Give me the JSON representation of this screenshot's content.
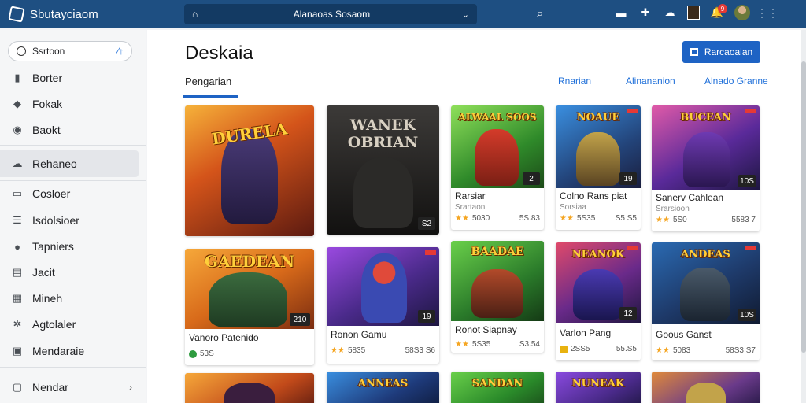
{
  "topbar": {
    "brand": "Sbutayciaom",
    "search_text": "Alanaoas Sosaom",
    "notification_count": "9"
  },
  "sidebar": {
    "search_placeholder": "Ssrtoon",
    "items": [
      {
        "label": "Borter",
        "icon": "bookmark-icon"
      },
      {
        "label": "Fokak",
        "icon": "pin-icon"
      },
      {
        "label": "Baokt",
        "icon": "compass-icon"
      },
      {
        "label": "Rehaneo",
        "icon": "cloud-icon",
        "active": true
      },
      {
        "label": "Cosloer",
        "icon": "monitor-icon"
      },
      {
        "label": "Isdolsioer",
        "icon": "list-icon"
      },
      {
        "label": "Tapniers",
        "icon": "user-icon"
      },
      {
        "label": "Jacit",
        "icon": "document-icon"
      },
      {
        "label": "Mineh",
        "icon": "calendar-icon"
      },
      {
        "label": "Agtolaler",
        "icon": "gear-icon"
      },
      {
        "label": "Mendaraie",
        "icon": "grid-icon"
      },
      {
        "label": "Nendar",
        "icon": "box-icon"
      }
    ]
  },
  "main": {
    "title": "Deskaia",
    "primary_button": "Rarcaoaian",
    "tab_active": "Pengarian",
    "tab_links": [
      "Rnarian",
      "Alinananion",
      "Alnado Granne"
    ]
  },
  "cards": [
    {
      "art_title": "DURELA",
      "rating": "",
      "name": "",
      "sub": "",
      "stars": "",
      "value": "",
      "price": ""
    },
    {
      "art_title": "WANEK OBRIAN",
      "rating": "S2",
      "name": "",
      "sub": "",
      "stars": "",
      "value": "",
      "price": ""
    },
    {
      "art_title": "ALWAAL SOOS",
      "rating": "2",
      "name": "Rarsiar",
      "sub": "Srartaon",
      "stars": "★★",
      "value": "5030",
      "price": "5S.83"
    },
    {
      "art_title": "NOAUE",
      "rating": "19",
      "name": "Colno Rans piat",
      "sub": "Sorsiaa",
      "stars": "★★",
      "value": "5S35",
      "price": "S5 S5"
    },
    {
      "art_title": "BUCEAN",
      "rating": "10S",
      "name": "Sanerv Cahlean",
      "sub": "Srarsioon",
      "stars": "★★",
      "value": "5S0",
      "price": "5583 7"
    },
    {
      "art_title": "GAEDEAN",
      "rating": "210",
      "name": "Vanoro Patenido",
      "sub": "",
      "stars": "",
      "value": "53S",
      "price": "",
      "lib": "green"
    },
    {
      "art_title": "",
      "rating": "19",
      "name": "Ronon Gamu",
      "sub": "",
      "stars": "★★",
      "value": "5835",
      "price": "58S3 S6"
    },
    {
      "art_title": "BAADAE",
      "rating": "",
      "name": "Ronot Siapnay",
      "sub": "",
      "stars": "★★",
      "value": "5S35",
      "price": "S3.54"
    },
    {
      "art_title": "NEANOK",
      "rating": "12",
      "name": "Varlon Pang",
      "sub": "",
      "stars": "",
      "value": "2SS5",
      "price": "55.S5",
      "lib": "yellow"
    },
    {
      "art_title": "ANDEAS",
      "rating": "10S",
      "name": "Goous Ganst",
      "sub": "",
      "stars": "★★",
      "value": "5083",
      "price": "58S3 S7"
    },
    {
      "art_title": "",
      "rating": "",
      "name": "",
      "sub": "",
      "stars": "",
      "value": "",
      "price": ""
    },
    {
      "art_title": "ANNEAS",
      "rating": "",
      "name": "",
      "sub": "",
      "stars": "",
      "value": "",
      "price": ""
    },
    {
      "art_title": "SANDAN",
      "rating": "",
      "name": "",
      "sub": "",
      "stars": "",
      "value": "",
      "price": ""
    },
    {
      "art_title": "NUNEAK",
      "rating": "",
      "name": "",
      "sub": "",
      "stars": "",
      "value": "",
      "price": ""
    },
    {
      "art_title": "",
      "rating": "",
      "name": "",
      "sub": "",
      "stars": "",
      "value": "",
      "price": ""
    }
  ],
  "colors": {
    "topbar": "#1e4f82",
    "accent": "#1e63c4",
    "link": "#1e6fd9"
  }
}
